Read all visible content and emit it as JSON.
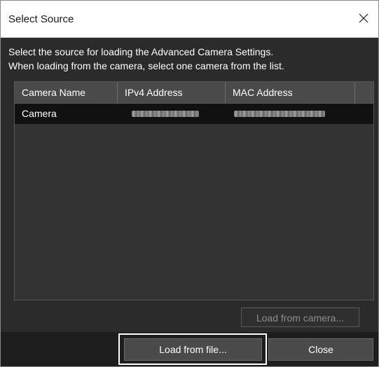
{
  "dialog": {
    "title": "Select Source",
    "close_icon": "close-icon"
  },
  "instructions": {
    "line1": "Select the source for loading the Advanced Camera Settings.",
    "line2": "When loading from the camera, select one camera from the list."
  },
  "table": {
    "columns": [
      "Camera Name",
      "IPv4 Address",
      "MAC Address"
    ],
    "rows": [
      {
        "camera_name": "Camera",
        "ipv4_address": "",
        "mac_address": ""
      }
    ]
  },
  "buttons": {
    "load_from_camera": "Load from camera...",
    "load_from_file": "Load from file...",
    "close": "Close"
  }
}
